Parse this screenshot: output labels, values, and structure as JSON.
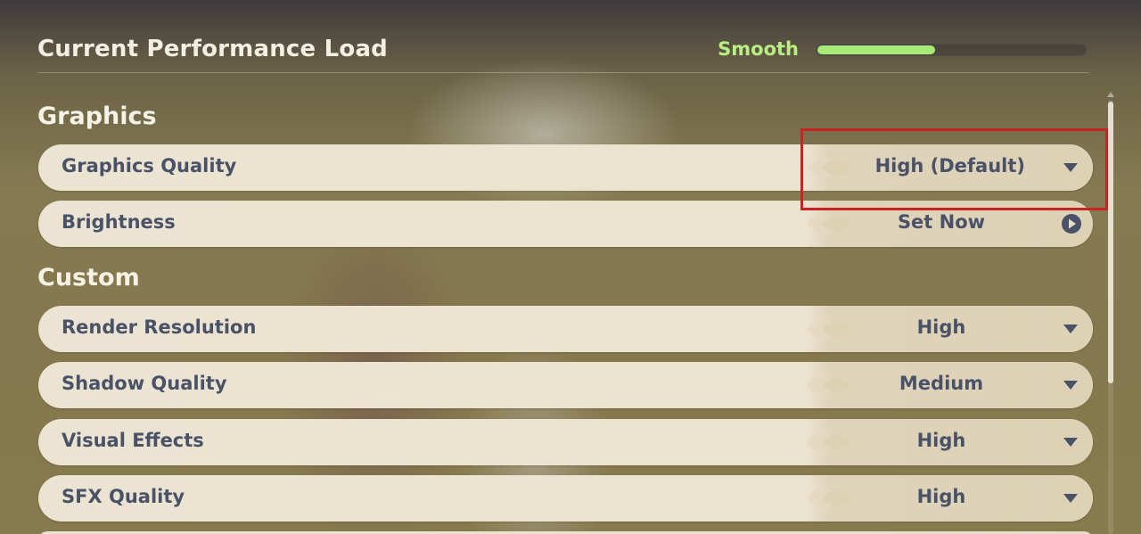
{
  "header": {
    "title": "Current Performance Load",
    "load_status": "Smooth",
    "load_progress": 0.44,
    "load_color": "#a7ea77"
  },
  "sections": {
    "graphics": {
      "title": "Graphics"
    },
    "custom": {
      "title": "Custom"
    }
  },
  "rows": {
    "graphics_quality": {
      "label": "Graphics Quality",
      "value": "High (Default)",
      "icon": "caret-down-icon"
    },
    "brightness": {
      "label": "Brightness",
      "value": "Set Now",
      "icon": "arrow-right-circle-icon"
    },
    "render_resolution": {
      "label": "Render Resolution",
      "value": "High",
      "icon": "caret-down-icon"
    },
    "shadow_quality": {
      "label": "Shadow Quality",
      "value": "Medium",
      "icon": "caret-down-icon"
    },
    "visual_effects": {
      "label": "Visual Effects",
      "value": "High",
      "icon": "caret-down-icon"
    },
    "sfx_quality": {
      "label": "SFX Quality",
      "value": "High",
      "icon": "caret-down-icon"
    }
  },
  "colors": {
    "highlight": "#c92323",
    "text_dark": "#4a5268",
    "text_light": "#f4efe2"
  }
}
